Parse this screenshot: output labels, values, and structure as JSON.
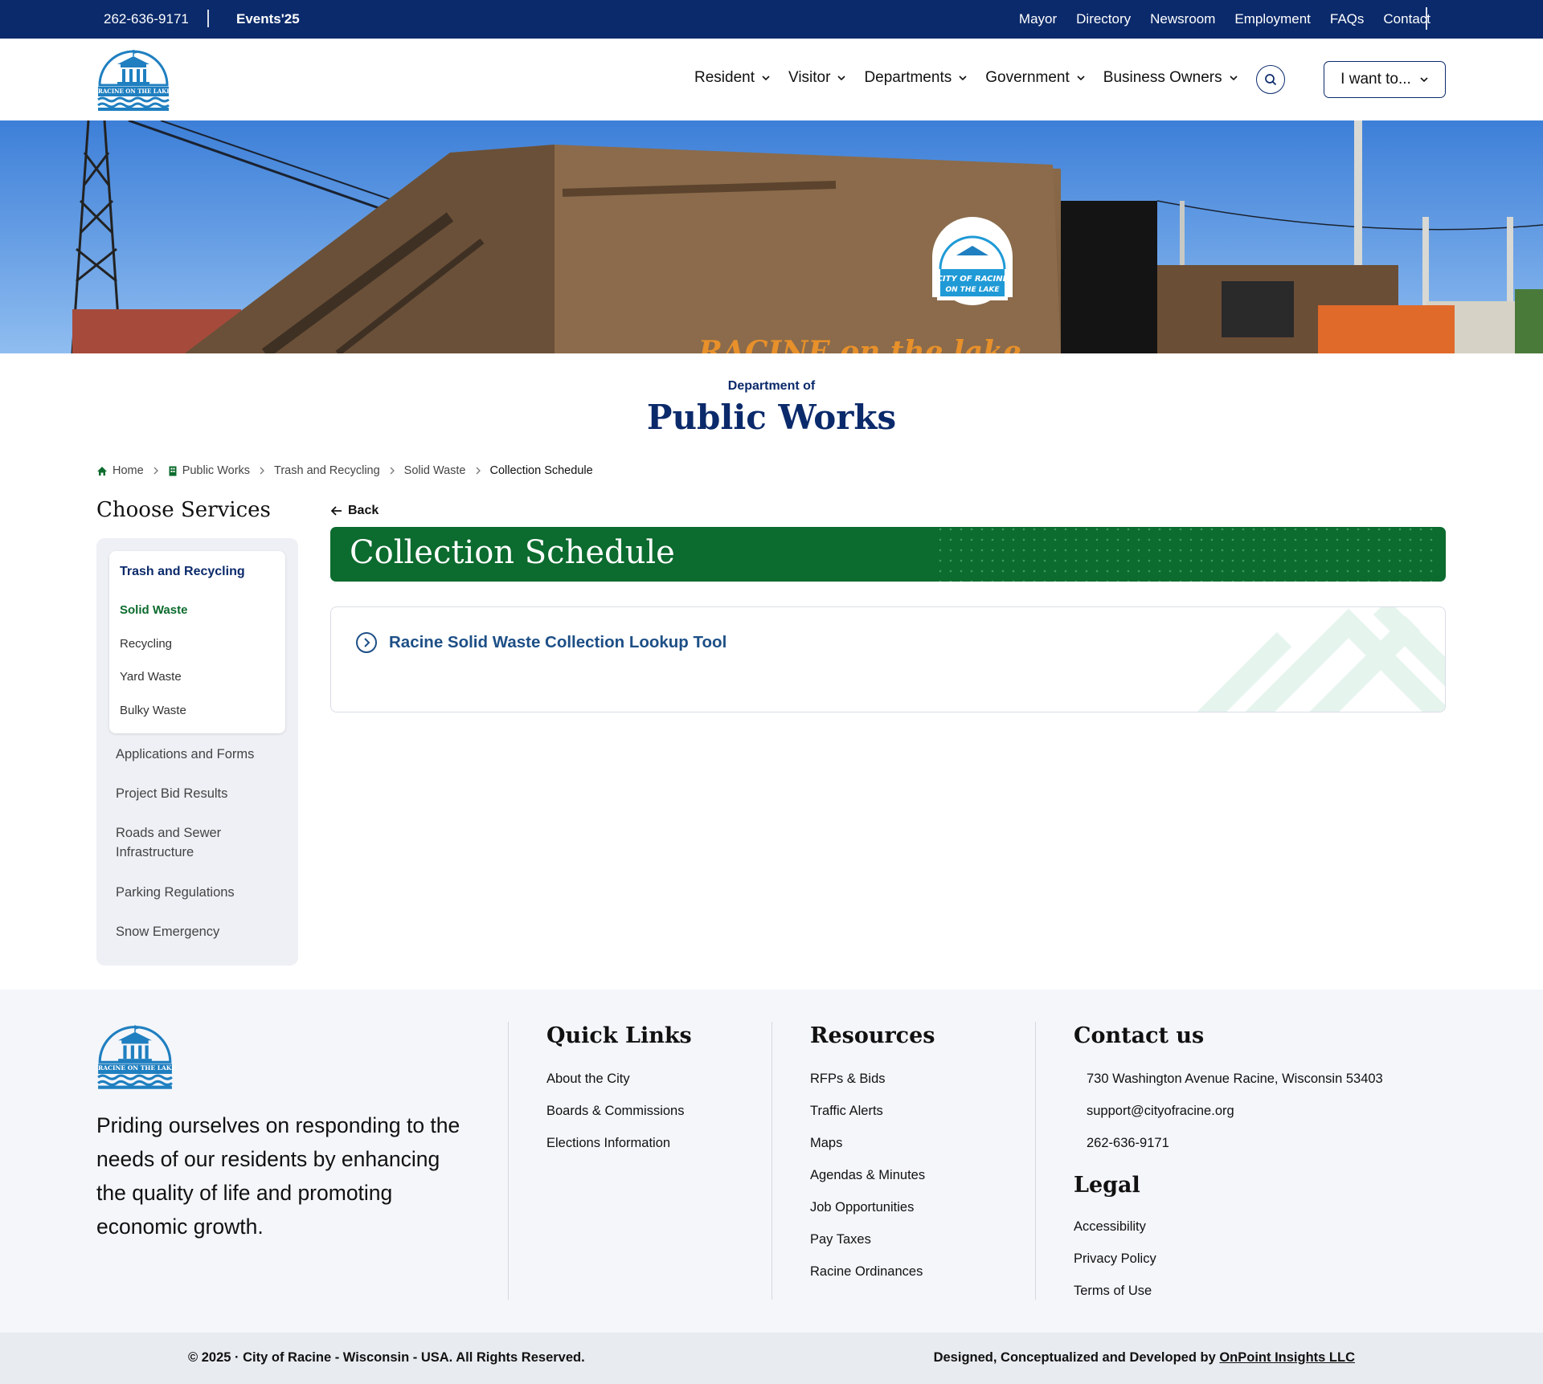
{
  "topbar": {
    "phone": "262-636-9171",
    "events": "Events'25",
    "links": [
      "Mayor",
      "Directory",
      "Newsroom",
      "Employment",
      "FAQs",
      "Contact"
    ]
  },
  "header": {
    "logo_text": "RACINE ON THE LAKE",
    "nav": [
      "Resident",
      "Visitor",
      "Departments",
      "Government",
      "Business Owners"
    ],
    "cta_label": "I want to..."
  },
  "hero": {
    "truck_logo_line1": "CITY OF RACINE",
    "truck_logo_line2": "ON THE LAKE",
    "truck_script": "RACINE on the lake"
  },
  "department": {
    "prefix": "Department of",
    "name": "Public Works"
  },
  "breadcrumb": [
    "Home",
    "Public Works",
    "Trash and Recycling",
    "Solid Waste",
    "Collection Schedule"
  ],
  "sidebar": {
    "title": "Choose Services",
    "group_title": "Trash and Recycling",
    "group_items": [
      "Solid Waste",
      "Recycling",
      "Yard Waste",
      "Bulky Waste"
    ],
    "active_item": "Solid Waste",
    "links": [
      "Applications and Forms",
      "Project Bid Results",
      "Roads and Sewer Infrastructure",
      "Parking Regulations",
      "Snow Emergency"
    ]
  },
  "main": {
    "back_label": "Back",
    "page_title": "Collection Schedule",
    "lookup_link": "Racine Solid Waste Collection Lookup Tool"
  },
  "footer": {
    "logo_text": "RACINE ON THE LAKE",
    "tagline": "Priding ourselves on responding to the needs of our residents by enhancing the quality of life and promoting economic growth.",
    "quick_links": {
      "title": "Quick Links",
      "items": [
        "About the City",
        "Boards & Commissions",
        "Elections Information"
      ]
    },
    "resources": {
      "title": "Resources",
      "items": [
        "RFPs & Bids",
        "Traffic Alerts",
        "Maps",
        "Agendas & Minutes",
        "Job Opportunities",
        "Pay Taxes",
        "Racine Ordinances"
      ]
    },
    "contact": {
      "title": "Contact us",
      "address": "730 Washington Avenue Racine, Wisconsin 53403",
      "email": "support@cityofracine.org",
      "phone": "262-636-9171"
    },
    "legal": {
      "title": "Legal",
      "items": [
        "Accessibility",
        "Privacy Policy",
        "Terms of Use"
      ]
    },
    "copyright": "© 2025 · City of Racine - Wisconsin - USA. All Rights Reserved.",
    "credit_prefix": "Designed, Conceptualized and Developed by",
    "credit_link": "OnPoint Insights LLC"
  },
  "colors": {
    "navy": "#0b2a6b",
    "green": "#0c6b2e",
    "link_blue": "#1d4f86",
    "footer_bg": "#f4f6fa"
  }
}
